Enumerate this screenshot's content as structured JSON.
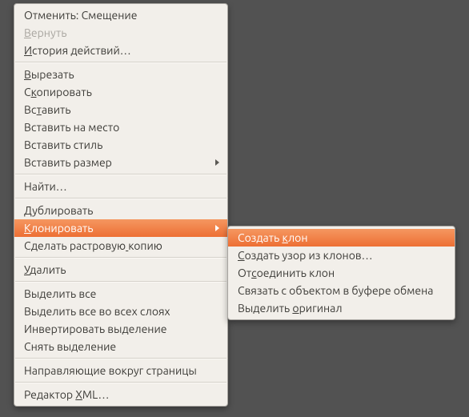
{
  "main_menu": {
    "groups": [
      [
        {
          "id": "undo",
          "label": "Отменить: Смещение",
          "disabled": false,
          "submenu": false
        },
        {
          "id": "redo",
          "label": "Вернуть",
          "disabled": true,
          "submenu": false,
          "underline": 0
        },
        {
          "id": "history",
          "label": "История действий…",
          "disabled": false,
          "submenu": false,
          "underline": 0
        }
      ],
      [
        {
          "id": "cut",
          "label": "Вырезать",
          "underline": 0
        },
        {
          "id": "copy",
          "label": "Скопировать",
          "underline": 1
        },
        {
          "id": "paste",
          "label": "Вставить",
          "underline": 2
        },
        {
          "id": "paste-in-place",
          "label": "Вставить на место"
        },
        {
          "id": "paste-style",
          "label": "Вставить стиль"
        },
        {
          "id": "paste-size",
          "label": "Вставить размер",
          "submenu": true
        }
      ],
      [
        {
          "id": "find",
          "label": "Найти…"
        }
      ],
      [
        {
          "id": "duplicate",
          "label": "Дублировать"
        },
        {
          "id": "clone",
          "label": "Клонировать",
          "submenu": true,
          "highlight": true,
          "underline": 0
        },
        {
          "id": "bitmap-copy",
          "label": "Сделать растровую копию",
          "underline": 17
        }
      ],
      [
        {
          "id": "delete",
          "label": "Удалить",
          "underline": 0
        }
      ],
      [
        {
          "id": "select-all",
          "label": "Выделить все"
        },
        {
          "id": "select-all-layers",
          "label": "Выделить все во всех слоях"
        },
        {
          "id": "invert-selection",
          "label": "Инвертировать выделение"
        },
        {
          "id": "deselect",
          "label": "Снять выделение"
        }
      ],
      [
        {
          "id": "guides",
          "label": "Направляющие вокруг страницы"
        }
      ],
      [
        {
          "id": "xml",
          "label": "Редактор XML…",
          "underline": 9
        }
      ]
    ]
  },
  "sub_menu": {
    "items": [
      {
        "id": "create-clone",
        "label": "Создать клон",
        "highlight": true,
        "underline": 8
      },
      {
        "id": "tile-clones",
        "label": "Создать узор из клонов…",
        "underline": 0
      },
      {
        "id": "unlink-clone",
        "label": "Отсоединить клон",
        "underline": 2
      },
      {
        "id": "link-clipboard",
        "label": "Связать с объектом в буфере обмена"
      },
      {
        "id": "select-original",
        "label": "Выделить оригинал",
        "underline": 9
      }
    ]
  }
}
